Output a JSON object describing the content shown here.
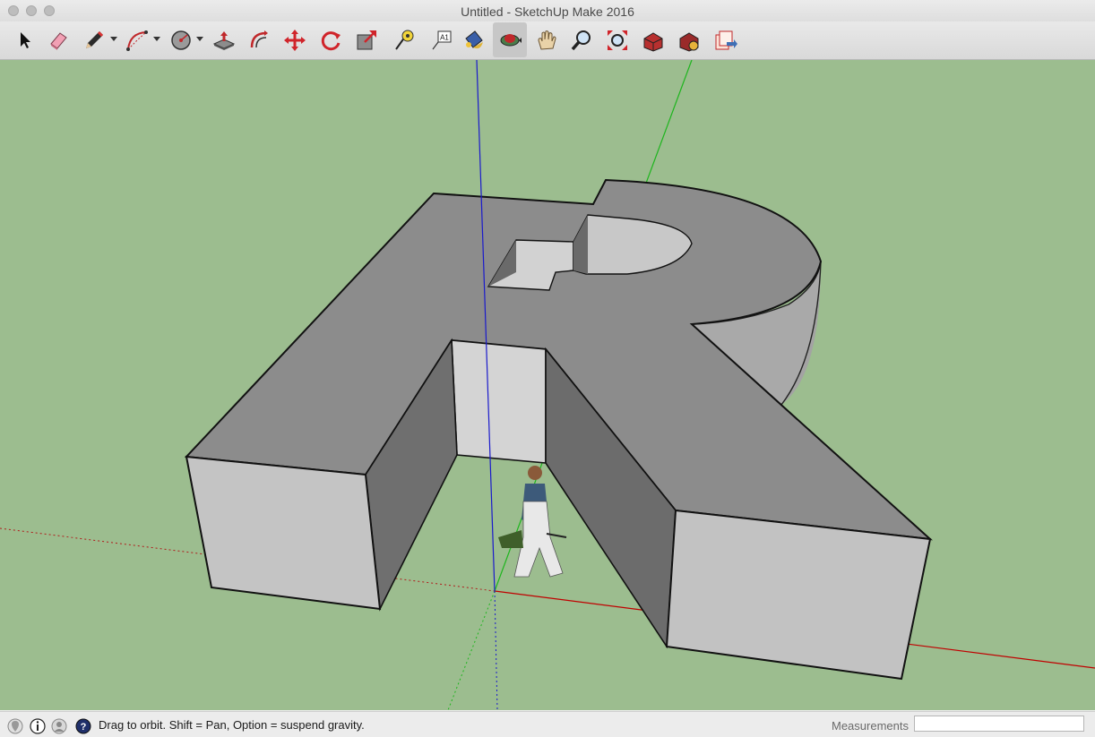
{
  "window": {
    "title": "Untitled - SketchUp Make 2016"
  },
  "toolbar": {
    "tools": [
      {
        "name": "select-tool",
        "icon": "arrow-cursor-icon"
      },
      {
        "name": "eraser-tool",
        "icon": "eraser-icon"
      },
      {
        "name": "line-tool",
        "icon": "pencil-icon",
        "dropdown": true
      },
      {
        "name": "arc-tool",
        "icon": "arc-icon",
        "dropdown": true
      },
      {
        "name": "shapes-tool",
        "icon": "circle-shape-icon",
        "dropdown": true
      },
      {
        "name": "push-pull-tool",
        "icon": "push-pull-icon"
      },
      {
        "name": "offset-tool",
        "icon": "offset-icon"
      },
      {
        "name": "move-tool",
        "icon": "move-arrows-icon"
      },
      {
        "name": "rotate-tool",
        "icon": "rotate-icon"
      },
      {
        "name": "scale-tool",
        "icon": "scale-icon"
      },
      {
        "name": "tape-measure-tool",
        "icon": "tape-measure-icon"
      },
      {
        "name": "text-tool",
        "icon": "text-label-icon",
        "label": "A1"
      },
      {
        "name": "paint-bucket-tool",
        "icon": "paint-bucket-icon"
      },
      {
        "name": "orbit-tool",
        "icon": "orbit-icon",
        "active": true
      },
      {
        "name": "pan-tool",
        "icon": "hand-icon"
      },
      {
        "name": "zoom-tool",
        "icon": "magnifier-icon"
      },
      {
        "name": "zoom-extents-tool",
        "icon": "zoom-extents-icon"
      },
      {
        "name": "3d-warehouse-tool",
        "icon": "warehouse-icon"
      },
      {
        "name": "extension-warehouse-tool",
        "icon": "extension-warehouse-icon"
      },
      {
        "name": "send-to-layout-tool",
        "icon": "layout-icon"
      }
    ]
  },
  "statusbar": {
    "icons": [
      "geolocation-icon",
      "credits-icon",
      "user-icon",
      "help-icon"
    ],
    "help_glyph": "?",
    "message": "Drag to orbit. Shift = Pan, Option = suspend gravity.",
    "measurements_label": "Measurements",
    "measurements_value": ""
  },
  "colors": {
    "sky_ground": "#9cbd8f",
    "model_top": "#8c8c8c",
    "model_front": "#c4c4c4",
    "model_side": "#6e6e6e",
    "axis_red": "#c00000",
    "axis_green": "#1db51d",
    "axis_blue": "#1a1acc",
    "active_tool_bg": "#c7c7c7"
  }
}
